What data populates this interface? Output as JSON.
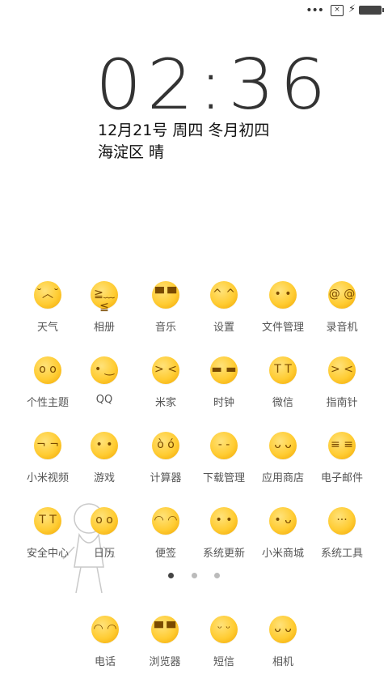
{
  "status": {
    "more": "•••",
    "sim": "×",
    "charging": "⚡"
  },
  "lockscreen": {
    "time": "02:36",
    "date": "12月21号 周四 冬月初四",
    "weather": "海淀区 晴"
  },
  "apps": [
    {
      "label": "天气",
      "glyph": "˘︿˘"
    },
    {
      "label": "相册",
      "glyph": "≧﹏≦"
    },
    {
      "label": "音乐",
      "glyph": "▀ ▀"
    },
    {
      "label": "设置",
      "glyph": "^ ^"
    },
    {
      "label": "文件管理",
      "glyph": "• •"
    },
    {
      "label": "录音机",
      "glyph": "@ @"
    },
    {
      "label": "个性主题",
      "glyph": "o o"
    },
    {
      "label": "QQ",
      "glyph": "• ‿"
    },
    {
      "label": "米家",
      "glyph": "> <"
    },
    {
      "label": "时钟",
      "glyph": "▬ ▬"
    },
    {
      "label": "微信",
      "glyph": "T T"
    },
    {
      "label": "指南针",
      "glyph": "> <"
    },
    {
      "label": "小米视频",
      "glyph": "¬ ¬"
    },
    {
      "label": "游戏",
      "glyph": "• •"
    },
    {
      "label": "计算器",
      "glyph": "ò ó"
    },
    {
      "label": "下载管理",
      "glyph": "- -"
    },
    {
      "label": "应用商店",
      "glyph": "ᴗ ᴗ"
    },
    {
      "label": "电子邮件",
      "glyph": "≡ ≡"
    },
    {
      "label": "安全中心",
      "glyph": "T T"
    },
    {
      "label": "日历",
      "glyph": "o o"
    },
    {
      "label": "便签",
      "glyph": "◠ ◠"
    },
    {
      "label": "系统更新",
      "glyph": "• •"
    },
    {
      "label": "小米商城",
      "glyph": "• ᴗ"
    },
    {
      "label": "系统工具",
      "glyph": "···"
    }
  ],
  "dock": [
    {
      "label": "电话",
      "glyph": "◠ ◠"
    },
    {
      "label": "浏览器",
      "glyph": "▀ ▀"
    },
    {
      "label": "短信",
      "glyph": "ᵕ ᵕ"
    },
    {
      "label": "相机",
      "glyph": "ᴗ ᴗ"
    }
  ],
  "pager": {
    "count": 3,
    "active": 0
  }
}
